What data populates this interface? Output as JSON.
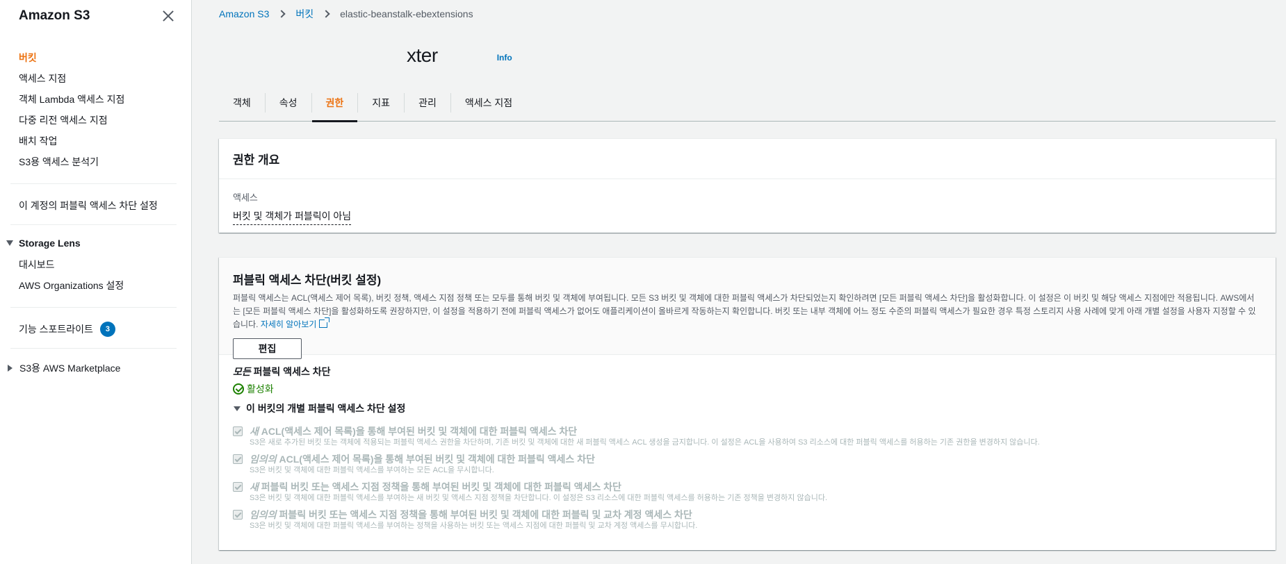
{
  "sidebar": {
    "title": "Amazon S3",
    "items": [
      {
        "label": "버킷",
        "active": true
      },
      {
        "label": "액세스 지점"
      },
      {
        "label": "객체 Lambda 액세스 지점"
      },
      {
        "label": "다중 리전 액세스 지점"
      },
      {
        "label": "배치 작업"
      },
      {
        "label": "S3용 액세스 분석기"
      }
    ],
    "account_block_label": "이 계정의 퍼블릭 액세스 차단 설정",
    "storage_lens": {
      "label": "Storage Lens",
      "items": [
        "대시보드",
        "AWS Organizations 설정"
      ]
    },
    "feature_spotlight": {
      "label": "기능 스포트라이트",
      "badge": "3"
    },
    "marketplace": "S3용 AWS Marketplace"
  },
  "breadcrumb": {
    "root": "Amazon S3",
    "buckets": "버킷",
    "current": "elastic-beanstalk-ebextensions"
  },
  "page": {
    "title": "xter",
    "info": "Info"
  },
  "tabs": [
    "객체",
    "속성",
    "권한",
    "지표",
    "관리",
    "액세스 지점"
  ],
  "active_tab": "권한",
  "overview": {
    "title": "권한 개요",
    "access_label": "액세스",
    "access_value": "버킷 및 객체가 퍼블릭이 아님"
  },
  "block_public": {
    "title": "퍼블릭 액세스 차단(버킷 설정)",
    "description": "퍼블릭 액세스는 ACL(액세스 제어 목록), 버킷 정책, 액세스 지점 정책 또는 모두를 통해 버킷 및 객체에 부여됩니다. 모든 S3 버킷 및 객체에 대한 퍼블릭 액세스가 차단되었는지 확인하려면 [모든 퍼블릭 액세스 차단]을 활성화합니다. 이 설정은 이 버킷 및 해당 액세스 지점에만 적용됩니다. AWS에서는 [모든 퍼블릭 액세스 차단]을 활성화하도록 권장하지만, 이 설정을 적용하기 전에 퍼블릭 액세스가 없어도 애플리케이션이 올바르게 작동하는지 확인합니다. 버킷 또는 내부 객체에 어느 정도 수준의 퍼블릭 액세스가 필요한 경우 특정 스토리지 사용 사례에 맞게 아래 개별 설정을 사용자 지정할 수 있습니다.",
    "learn_more": "자세히 알아보기",
    "edit_label": "편집",
    "all_block_em": "모든",
    "all_block_rest": " 퍼블릭 액세스 차단",
    "status": "활성화",
    "expander": "이 버킷의 개별 퍼블릭 액세스 차단 설정",
    "settings": [
      {
        "em": "새",
        "title": " ACL(액세스 제어 목록)을 통해 부여된 버킷 및 객체에 대한 퍼블릭 액세스 차단",
        "desc": "S3은 새로 추가된 버킷 또는 객체에 적용되는 퍼블릭 액세스 권한을 차단하며, 기존 버킷 및 객체에 대한 새 퍼블릭 액세스 ACL 생성을 금지합니다. 이 설정은 ACL을 사용하여 S3 리소스에 대한 퍼블릭 액세스를 허용하는 기존 권한을 변경하지 않습니다."
      },
      {
        "em": "임의의",
        "title": " ACL(액세스 제어 목록)을 통해 부여된 버킷 및 객체에 대한 퍼블릭 액세스 차단",
        "desc": "S3은 버킷 및 객체에 대한 퍼블릭 액세스를 부여하는 모든 ACL을 무시합니다."
      },
      {
        "em": "새",
        "title": " 퍼블릭 버킷 또는 액세스 지점 정책을 통해 부여된 버킷 및 객체에 대한 퍼블릭 액세스 차단",
        "desc": "S3은 버킷 및 객체에 대한 퍼블릭 액세스를 부여하는 새 버킷 및 액세스 지점 정책을 차단합니다. 이 설정은 S3 리소스에 대한 퍼블릭 액세스를 허용하는 기존 정책을 변경하지 않습니다."
      },
      {
        "em": "임의의",
        "title": " 퍼블릭 버킷 또는 액세스 지점 정책을 통해 부여된 버킷 및 객체에 대한 퍼블릭 및 교차 계정 액세스 차단",
        "desc": "S3은 버킷 및 객체에 대한 퍼블릭 액세스를 부여하는 정책을 사용하는 버킷 또는 액세스 지점에 대한 퍼블릭 및 교차 계정 액세스를 무시합니다."
      }
    ]
  },
  "colors": {
    "accent": "#ec7211",
    "link": "#0073bb",
    "success": "#1d8102",
    "disabled": "#aab7b8"
  }
}
